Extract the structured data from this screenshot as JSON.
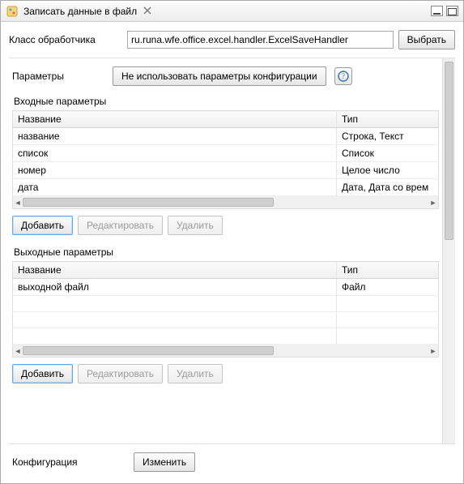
{
  "window": {
    "title": "Записать данные в файл"
  },
  "handler": {
    "label": "Класс обработчика",
    "value": "ru.runa.wfe.office.excel.handler.ExcelSaveHandler",
    "select_btn": "Выбрать"
  },
  "params": {
    "label": "Параметры",
    "toggle_btn": "Не использовать параметры конфигурации"
  },
  "input_params": {
    "title": "Входные параметры",
    "columns": {
      "name": "Название",
      "type": "Тип"
    },
    "rows": [
      {
        "name": "название",
        "type": "Строка, Текст"
      },
      {
        "name": "список",
        "type": "Список"
      },
      {
        "name": "номер",
        "type": "Целое число"
      },
      {
        "name": "дата",
        "type": "Дата, Дата со врем"
      }
    ],
    "add_btn": "Добавить",
    "edit_btn": "Редактировать",
    "delete_btn": "Удалить"
  },
  "output_params": {
    "title": "Выходные параметры",
    "columns": {
      "name": "Название",
      "type": "Тип"
    },
    "rows": [
      {
        "name": "выходной файл",
        "type": "Файл"
      }
    ],
    "add_btn": "Добавить",
    "edit_btn": "Редактировать",
    "delete_btn": "Удалить"
  },
  "config": {
    "label": "Конфигурация",
    "edit_btn": "Изменить"
  }
}
